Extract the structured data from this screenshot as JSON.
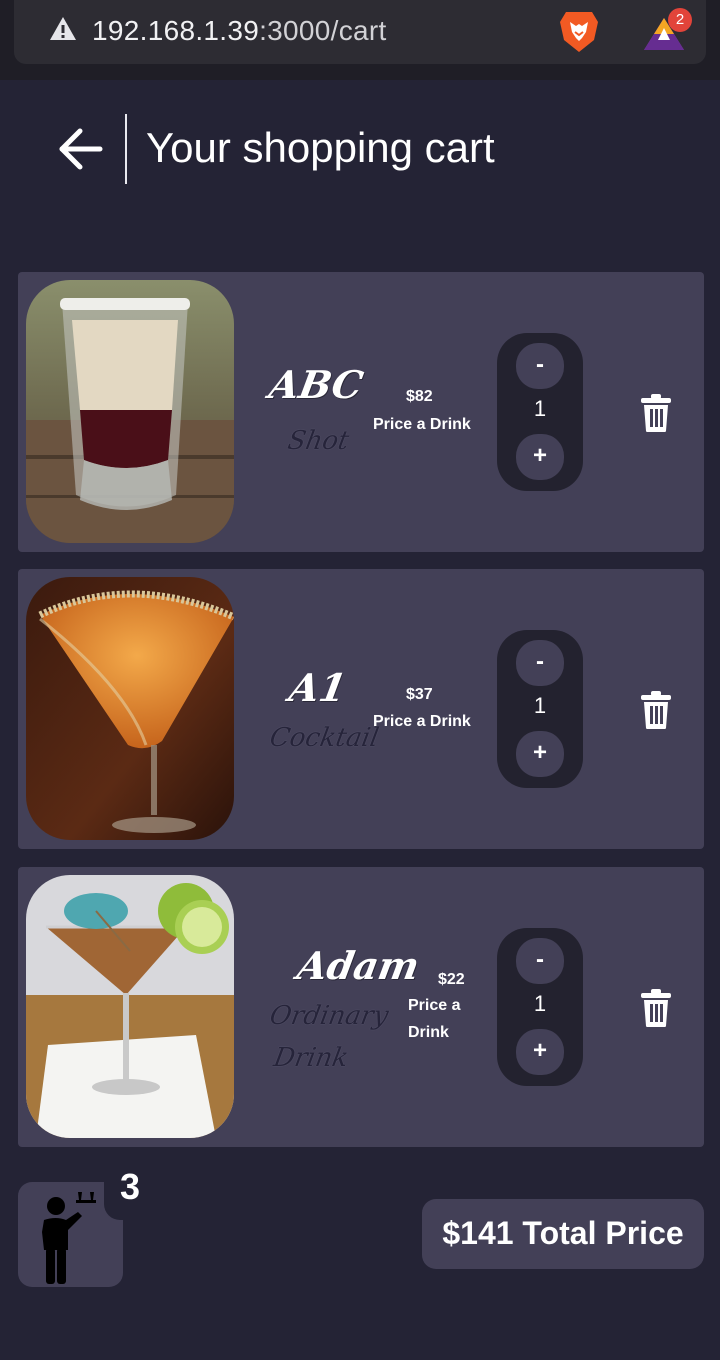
{
  "browser": {
    "url_host": "192.168.1.39",
    "url_path": ":3000/cart",
    "rewards_badge": "2",
    "icons": [
      "warning-icon",
      "brave-lion-icon",
      "brave-rewards-icon"
    ]
  },
  "header": {
    "title": "Your shopping cart",
    "back_icon": "arrow-left-icon"
  },
  "cart": {
    "items": [
      {
        "name": "ABC",
        "category": "Shot",
        "price": "$82",
        "price_label": "Price a Drink",
        "decrement_label": "-",
        "quantity": "1",
        "increment_label": "+"
      },
      {
        "name": "A1",
        "category": "Cocktail",
        "price": "$37",
        "price_label": "Price a Drink",
        "decrement_label": "-",
        "quantity": "1",
        "increment_label": "+"
      },
      {
        "name": "Adam",
        "category_line1": "Ordinary",
        "category_line2": "Drink",
        "price": "$22",
        "price_label_line1": "Price a",
        "price_label_line2": "Drink",
        "decrement_label": "-",
        "quantity": "1",
        "increment_label": "+"
      }
    ]
  },
  "footer": {
    "item_count": "3",
    "total": "$141 Total Price",
    "waiter_icon": "waiter-icon"
  },
  "colors": {
    "background": "#242335",
    "card": "#434057",
    "stepper": "#23222f"
  }
}
